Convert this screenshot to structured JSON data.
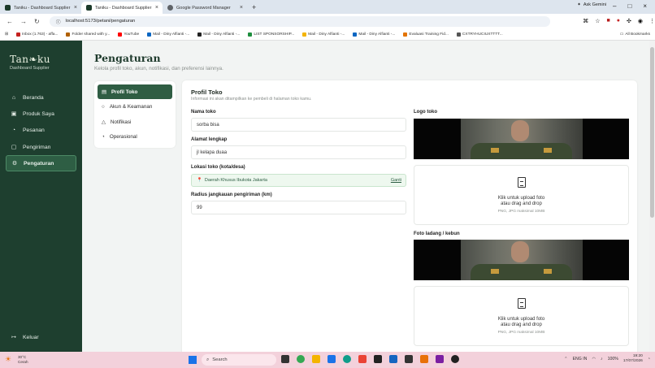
{
  "browser": {
    "tabs": [
      {
        "title": "Taniku - Dashboard Supplier"
      },
      {
        "title": "Taniku - Dashboard Supplier"
      },
      {
        "title": "Google Password Manager"
      }
    ],
    "url": "localhost:5173/petani/pengaturan",
    "ask_gemini": "Ask Gemini",
    "bookmarks": [
      {
        "label": "Inbox (1.763) - affa...",
        "color": "#c5221f"
      },
      {
        "label": "Folder shared with y...",
        "color": "#b06000"
      },
      {
        "label": "YouTube",
        "color": "#ff0000"
      },
      {
        "label": "Mail - Diny Alfianti -...",
        "color": "#0a66c2"
      },
      {
        "label": "Mail - Diny Alfianti -...",
        "color": "#222222"
      },
      {
        "label": "LIST SPONSORSHIP...",
        "color": "#1e8e3e"
      },
      {
        "label": "Mail - Diny Alfianti -...",
        "color": "#f4b400"
      },
      {
        "label": "Mail - Diny Alfianti -...",
        "color": "#0a66c2"
      },
      {
        "label": "Evaluasi Training Fid...",
        "color": "#e37400"
      },
      {
        "label": "CXTRYHUCIUXTTTT...",
        "color": "#555555"
      }
    ],
    "all_bookmarks": "All Bookmarks"
  },
  "sidebar": {
    "logo": "Tan❧ku",
    "subtitle": "Dashboard Supplier",
    "items": [
      {
        "label": "Beranda",
        "icon": "home-icon",
        "glyph": "⌂"
      },
      {
        "label": "Produk Saya",
        "icon": "box-icon",
        "glyph": "▣"
      },
      {
        "label": "Pesanan",
        "icon": "cart-icon",
        "glyph": "◔"
      },
      {
        "label": "Pengiriman",
        "icon": "truck-icon",
        "glyph": "▢"
      },
      {
        "label": "Pengaturan",
        "icon": "gear-icon",
        "glyph": "⚙"
      }
    ],
    "logout": "Keluar"
  },
  "page": {
    "title": "Pengaturan",
    "subtitle": "Kelola profil toko, akun, notifikasi, dan preferensi lainnya."
  },
  "subnav": [
    {
      "label": "Profil Toko",
      "glyph": "▤"
    },
    {
      "label": "Akun & Keamanan",
      "glyph": "○"
    },
    {
      "label": "Notifikasi",
      "glyph": "△"
    },
    {
      "label": "Operasional",
      "glyph": "◔"
    }
  ],
  "profile": {
    "title": "Profil Toko",
    "subtitle": "Informasi ini akan ditampilkan ke pembeli di halaman toko kamu.",
    "store_name_label": "Nama toko",
    "store_name": "sorba bisa",
    "address_label": "Alamat lengkap",
    "address": "jl kelapa duaa",
    "location_label": "Lokasi toko (kota/desa)",
    "location": "Daerah Khusus Ibukota Jakarta",
    "location_change": "Ganti",
    "radius_label": "Radius jangkauan pengiriman (km)",
    "radius": "99",
    "logo_label": "Logo toko",
    "farm_photo_label": "Foto ladang / kebun",
    "upload_line1": "Klik untuk upload foto",
    "upload_line2": "atau drag and drop",
    "upload_hint": "PNG, JPG maksimal 10MB"
  },
  "taskbar": {
    "temp": "30°C",
    "weather": "Cerah",
    "search": "Search",
    "lang": "ENG IN",
    "battery": "100%",
    "time": "19:20",
    "date": "17/07/2026"
  }
}
